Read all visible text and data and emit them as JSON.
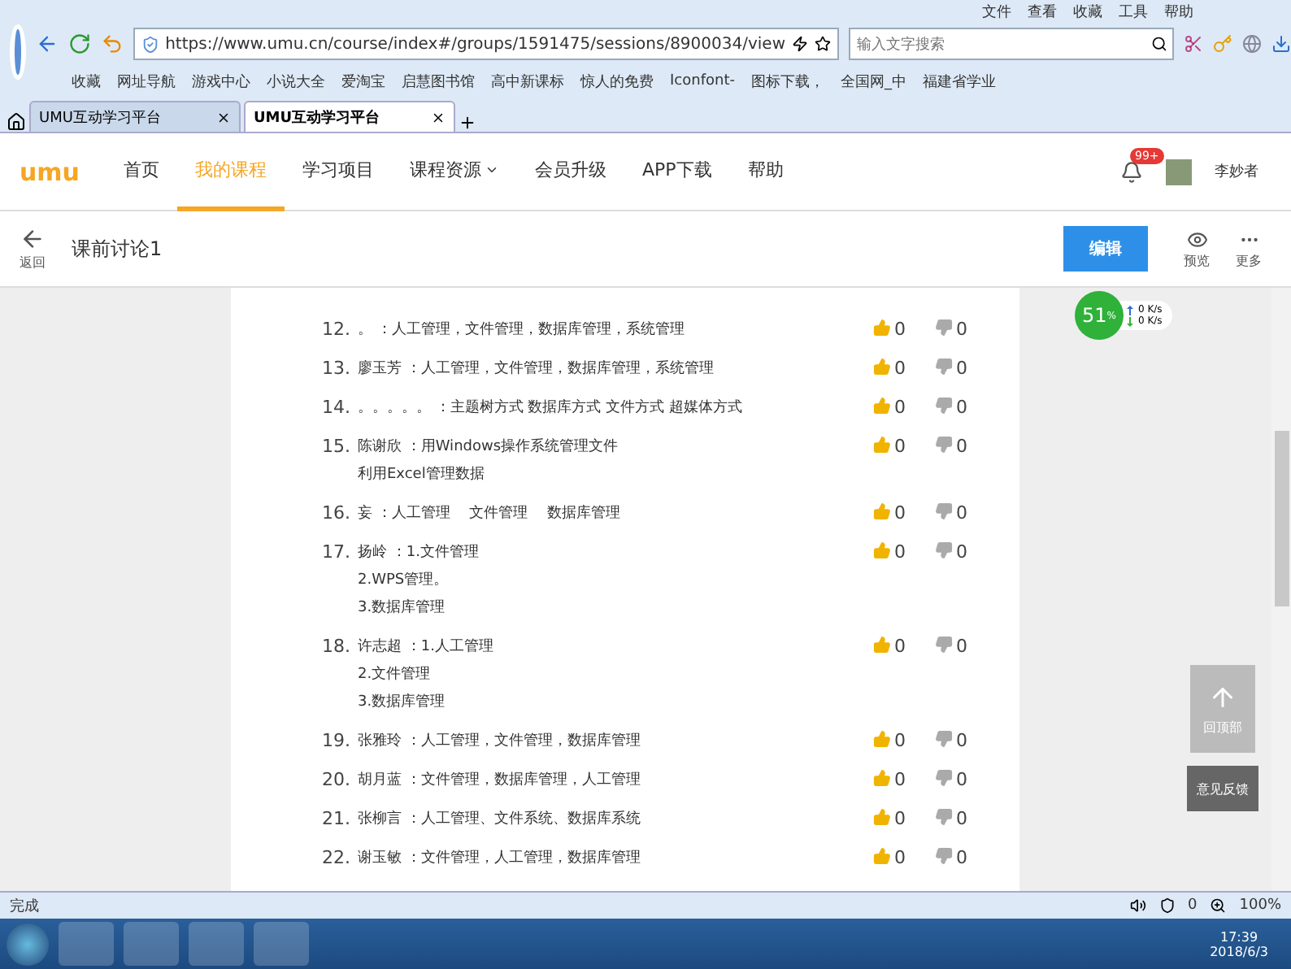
{
  "browser": {
    "menu": [
      "文件",
      "查看",
      "收藏",
      "工具",
      "帮助"
    ],
    "url": "https://www.umu.cn/course/index#/groups/1591475/sessions/8900034/view",
    "search": {
      "placeholder": "输入文字搜索"
    },
    "bookmarks": [
      "收藏",
      "网址导航",
      "游戏中心",
      "小说大全",
      "爱淘宝",
      "启慧图书馆",
      "高中新课标",
      "惊人的免费",
      "Iconfont-",
      "图标下载，",
      "全国网_中",
      "福建省学业"
    ],
    "tabs": [
      {
        "label": "UMU互动学习平台",
        "selected": false
      },
      {
        "label": "UMU互动学习平台",
        "selected": true
      }
    ]
  },
  "site": {
    "logo": "umu",
    "nav": [
      {
        "label": "首页",
        "selected": false,
        "dropdown": false
      },
      {
        "label": "我的课程",
        "selected": true,
        "dropdown": false
      },
      {
        "label": "学习项目",
        "selected": false,
        "dropdown": false
      },
      {
        "label": "课程资源",
        "selected": false,
        "dropdown": true
      },
      {
        "label": "会员升级",
        "selected": false,
        "dropdown": false
      },
      {
        "label": "APP下载",
        "selected": false,
        "dropdown": false
      },
      {
        "label": "帮助",
        "selected": false,
        "dropdown": false
      }
    ],
    "badge": "99+",
    "user": "李妙者"
  },
  "toolbar": {
    "back": "返回",
    "title": "课前讨论1",
    "edit": "编辑",
    "preview": "预览",
    "more": "更多"
  },
  "answers": [
    {
      "num": "12.",
      "lines": [
        "。 ：人工管理，文件管理，数据库管理，系统管理"
      ],
      "up": "0",
      "down": "0"
    },
    {
      "num": "13.",
      "lines": [
        "廖玉芳 ：人工管理，文件管理，数据库管理，系统管理"
      ],
      "up": "0",
      "down": "0"
    },
    {
      "num": "14.",
      "lines": [
        "。。。。。 ：主题树方式 数据库方式 文件方式 超媒体方式"
      ],
      "up": "0",
      "down": "0"
    },
    {
      "num": "15.",
      "lines": [
        "陈谢欣 ：用Windows操作系统管理文件",
        "利用Excel管理数据"
      ],
      "up": "0",
      "down": "0"
    },
    {
      "num": "16.",
      "lines": [
        "妄 ：人工管理　 文件管理　 数据库管理"
      ],
      "up": "0",
      "down": "0"
    },
    {
      "num": "17.",
      "lines": [
        "扬岭 ：1.文件管理",
        "2.WPS管理。",
        "3.数据库管理"
      ],
      "up": "0",
      "down": "0"
    },
    {
      "num": "18.",
      "lines": [
        "许志超 ：1.人工管理",
        "2.文件管理",
        "3.数据库管理"
      ],
      "up": "0",
      "down": "0"
    },
    {
      "num": "19.",
      "lines": [
        "张雅玲 ：人工管理，文件管理，数据库管理"
      ],
      "up": "0",
      "down": "0"
    },
    {
      "num": "20.",
      "lines": [
        "胡月蓝 ：文件管理，数据库管理，人工管理"
      ],
      "up": "0",
      "down": "0"
    },
    {
      "num": "21.",
      "lines": [
        "张柳言 ：人工管理、文件系统、数据库系统"
      ],
      "up": "0",
      "down": "0"
    },
    {
      "num": "22.",
      "lines": [
        "谢玉敏 ：文件管理，人工管理，数据库管理"
      ],
      "up": "0",
      "down": "0"
    }
  ],
  "speed": {
    "percent": "51",
    "percent_unit": "%",
    "up": "0 K/s",
    "down": "0 K/s"
  },
  "side_buttons": {
    "top": "回顶部",
    "feedback": "意见反馈"
  },
  "status_bar": {
    "text": "完成",
    "count": "0",
    "zoom": "100%"
  },
  "taskbar": {
    "time": "17:39",
    "date": "2018/6/3"
  }
}
